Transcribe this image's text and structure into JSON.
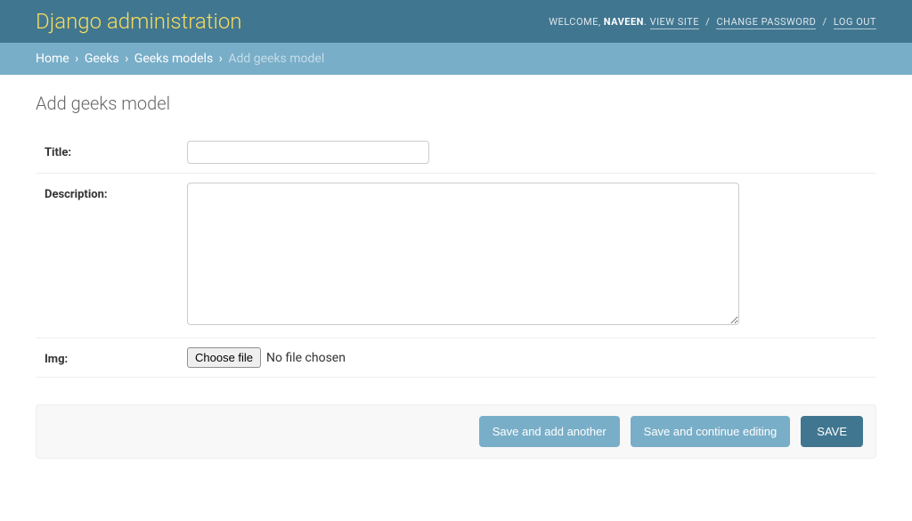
{
  "header": {
    "branding": "Django administration",
    "welcome_prefix": "WELCOME, ",
    "username": "NAVEEN",
    "view_site": "VIEW SITE",
    "change_password": "CHANGE PASSWORD",
    "log_out": "LOG OUT",
    "sep_dot": ". ",
    "sep_slash": " / "
  },
  "breadcrumbs": {
    "home": "Home",
    "app": "Geeks",
    "model": "Geeks models",
    "current": "Add geeks model",
    "sep": "›"
  },
  "page": {
    "title": "Add geeks model"
  },
  "form": {
    "title": {
      "label": "Title:",
      "value": ""
    },
    "description": {
      "label": "Description:",
      "value": ""
    },
    "img": {
      "label": "Img:",
      "button": "Choose file",
      "status": "No file chosen"
    }
  },
  "actions": {
    "save_add_another": "Save and add another",
    "save_continue": "Save and continue editing",
    "save": "SAVE"
  }
}
